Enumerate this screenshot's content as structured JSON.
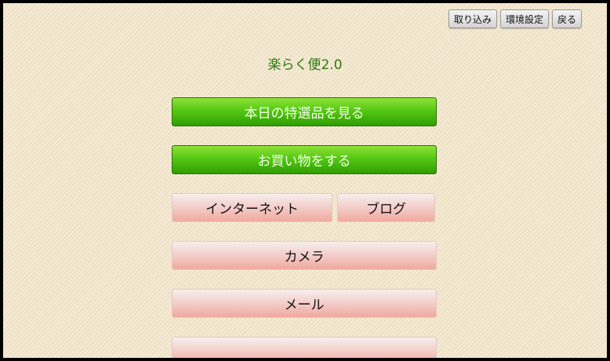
{
  "top_bar": {
    "import_label": "取り込み",
    "settings_label": "環境設定",
    "back_label": "戻る"
  },
  "app_title": "楽らく便2.0",
  "menu": {
    "special_items_label": "本日の特選品を見る",
    "shopping_label": "お買い物をする",
    "internet_label": "インターネット",
    "blog_label": "ブログ",
    "camera_label": "カメラ",
    "mail_label": "メール"
  },
  "colors": {
    "background": "#f3e6cb",
    "title_green": "#2f7a12",
    "primary_button": "#56c814",
    "secondary_button": "#f3cdc8"
  }
}
